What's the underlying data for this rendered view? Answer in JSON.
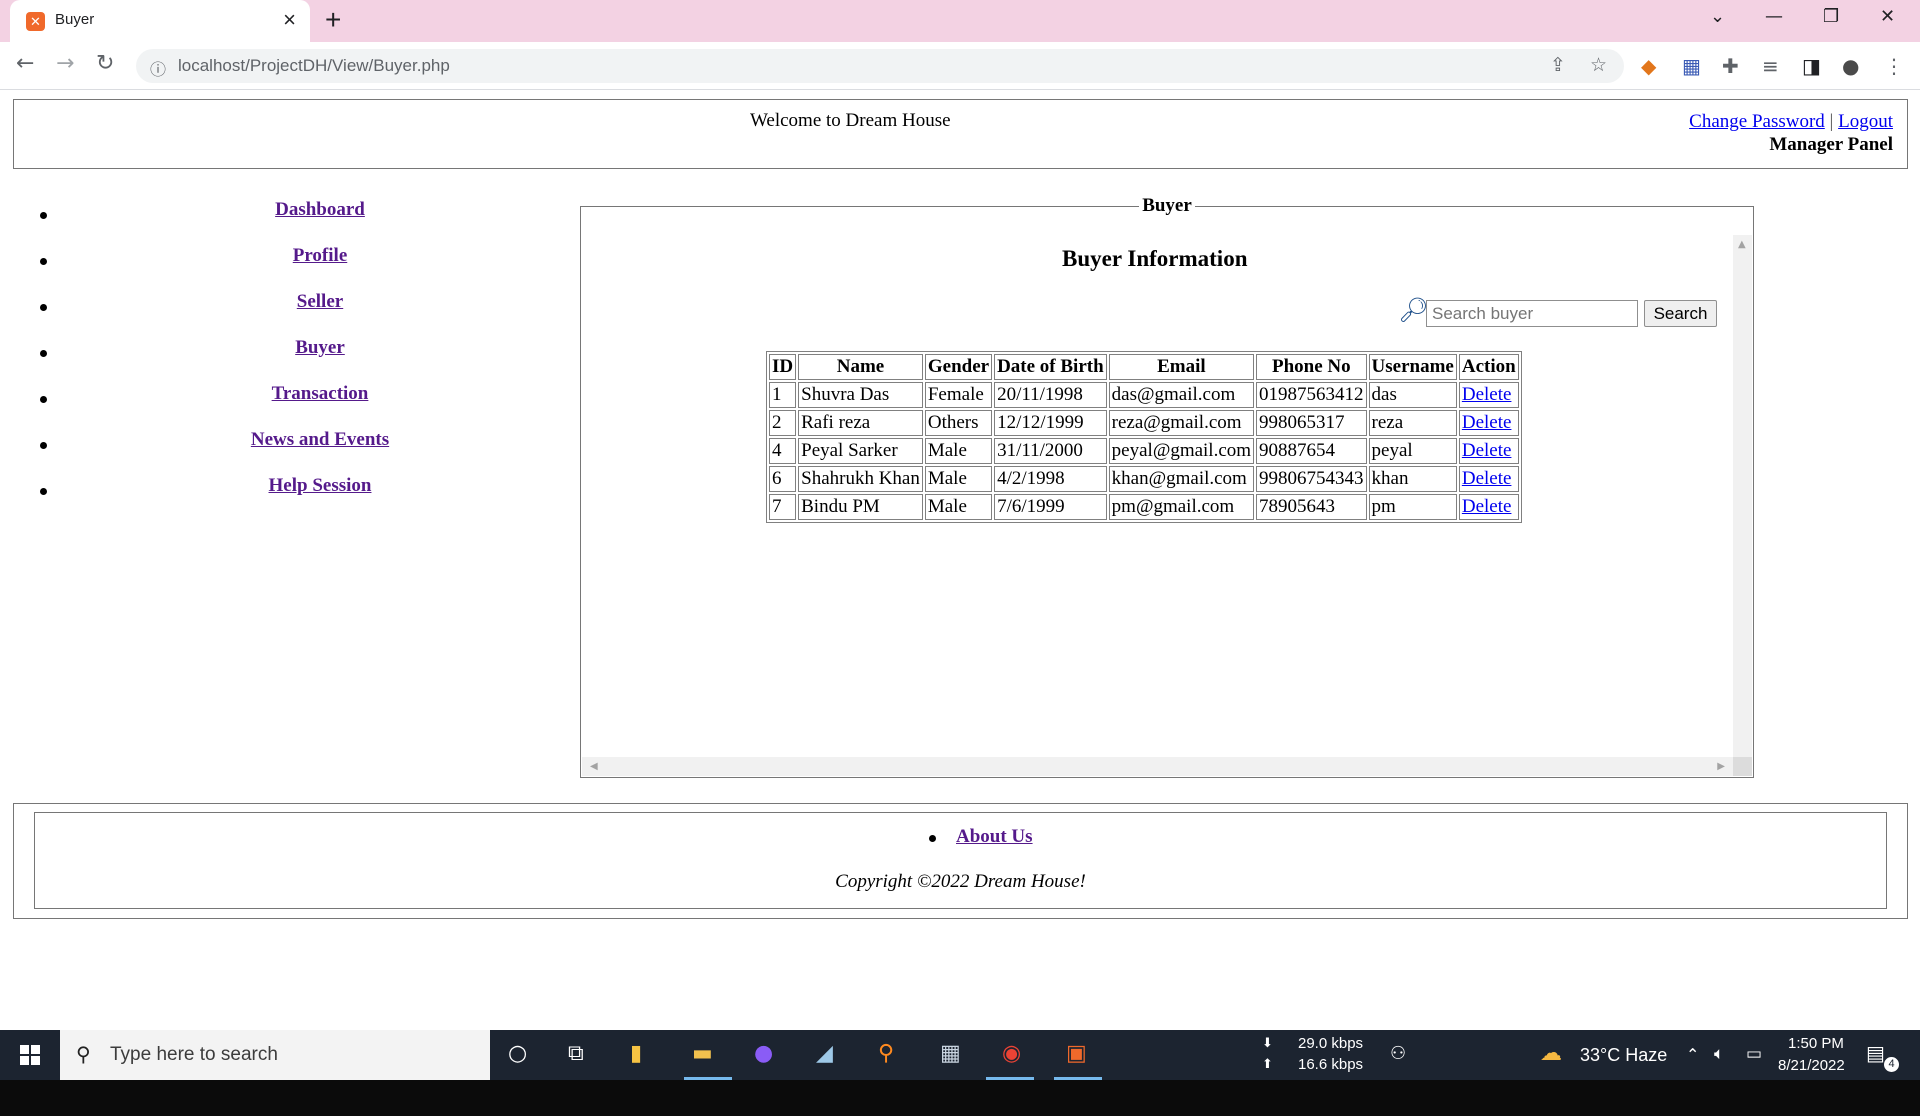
{
  "browser": {
    "tab_title": "Buyer",
    "url": "localhost/ProjectDH/View/Buyer.php"
  },
  "header": {
    "welcome": "Welcome to Dream House",
    "change_password": "Change Password",
    "separator": "|",
    "logout": "Logout",
    "panel_label": "Manager Panel"
  },
  "sidebar": {
    "items": [
      {
        "label": "Dashboard"
      },
      {
        "label": "Profile"
      },
      {
        "label": "Seller"
      },
      {
        "label": "Buyer"
      },
      {
        "label": "Transaction"
      },
      {
        "label": "News and Events"
      },
      {
        "label": "Help Session"
      }
    ]
  },
  "main": {
    "legend": "Buyer",
    "title": "Buyer Information",
    "search": {
      "placeholder": "Search buyer",
      "button": "Search"
    },
    "table": {
      "headers": [
        "ID",
        "Name",
        "Gender",
        "Date of Birth",
        "Email",
        "Phone No",
        "Username",
        "Action"
      ],
      "rows": [
        {
          "id": "1",
          "name": "Shuvra Das",
          "gender": "Female",
          "dob": "20/11/1998",
          "email": "das@gmail.com",
          "phone": "01987563412",
          "username": "das",
          "action": "Delete"
        },
        {
          "id": "2",
          "name": "Rafi reza",
          "gender": "Others",
          "dob": "12/12/1999",
          "email": "reza@gmail.com",
          "phone": "998065317",
          "username": "reza",
          "action": "Delete"
        },
        {
          "id": "4",
          "name": "Peyal Sarker",
          "gender": "Male",
          "dob": "31/11/2000",
          "email": "peyal@gmail.com",
          "phone": "90887654",
          "username": "peyal",
          "action": "Delete"
        },
        {
          "id": "6",
          "name": "Shahrukh Khan",
          "gender": "Male",
          "dob": "4/2/1998",
          "email": "khan@gmail.com",
          "phone": "99806754343",
          "username": "khan",
          "action": "Delete"
        },
        {
          "id": "7",
          "name": "Bindu PM",
          "gender": "Male",
          "dob": "7/6/1999",
          "email": "pm@gmail.com",
          "phone": "78905643",
          "username": "pm",
          "action": "Delete"
        }
      ]
    }
  },
  "footer": {
    "about": "About Us",
    "copyright": "Copyright ©2022 Dream House!"
  },
  "taskbar": {
    "search_placeholder": "Type here to search",
    "net_down": "29.0 kbps",
    "net_up": "16.6 kbps",
    "weather": "33°C  Haze",
    "time": "1:50 PM",
    "date": "8/21/2022",
    "notification_count": "4"
  }
}
